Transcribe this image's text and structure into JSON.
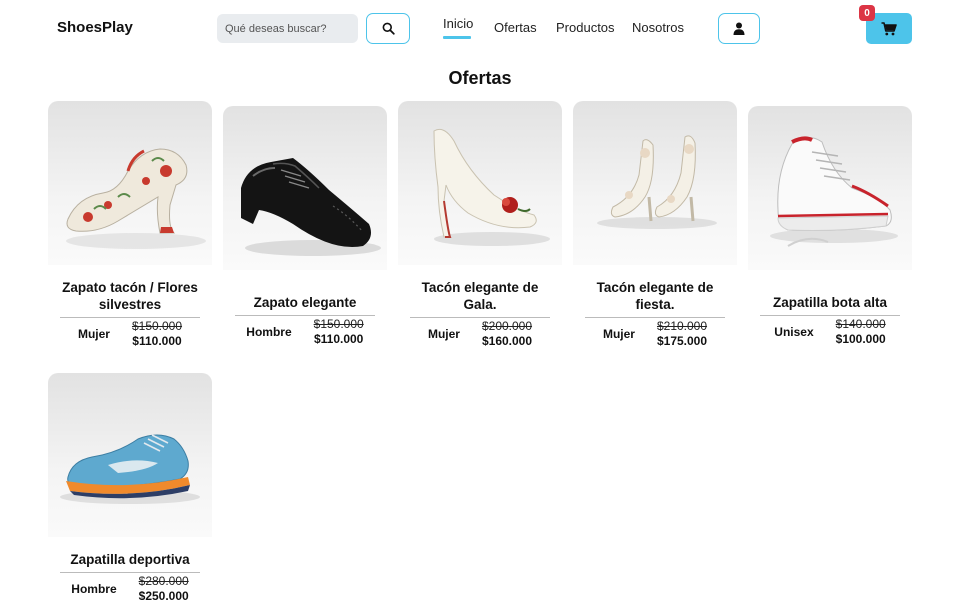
{
  "header": {
    "brand": "ShoesPlay",
    "search_placeholder": "Qué deseas buscar?",
    "nav": [
      {
        "label": "Inicio",
        "active": true
      },
      {
        "label": "Ofertas",
        "active": false
      },
      {
        "label": "Productos",
        "active": false
      },
      {
        "label": "Nosotros",
        "active": false
      }
    ],
    "cart_count": "0",
    "icons": {
      "search": "search-icon",
      "user": "user-icon",
      "cart": "cart-icon"
    }
  },
  "section_title": "Ofertas",
  "products": [
    {
      "name": "Zapato tacón / Flores silvestres",
      "gender": "Mujer",
      "old_price": "$150.000",
      "new_price": "$110.000",
      "image": "floral-heel"
    },
    {
      "name": "Zapato elegante",
      "gender": "Hombre",
      "old_price": "$150.000",
      "new_price": "$110.000",
      "image": "black-oxford"
    },
    {
      "name": "Tacón elegante de Gala.",
      "gender": "Mujer",
      "old_price": "$200.000",
      "new_price": "$160.000",
      "image": "white-stiletto"
    },
    {
      "name": "Tacón elegante de fiesta.",
      "gender": "Mujer",
      "old_price": "$210.000",
      "new_price": "$175.000",
      "image": "white-sandals"
    },
    {
      "name": "Zapatilla bota alta",
      "gender": "Unisex",
      "old_price": "$140.000",
      "new_price": "$100.000",
      "image": "high-top-sneaker"
    },
    {
      "name": "Zapatilla deportiva",
      "gender": "Hombre",
      "old_price": "$280.000",
      "new_price": "$250.000",
      "image": "running-shoe"
    }
  ],
  "colors": {
    "accent": "#4dc4ea",
    "badge": "#dc3545"
  }
}
